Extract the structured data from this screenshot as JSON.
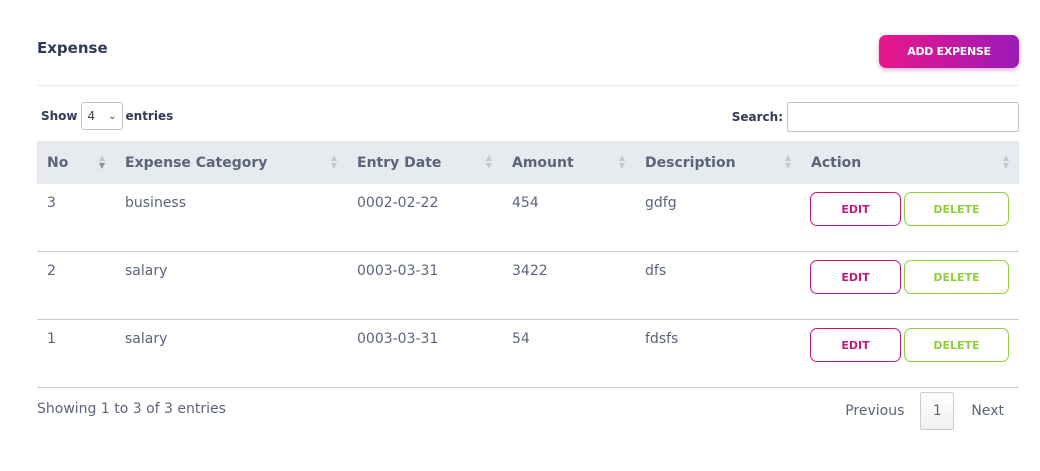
{
  "header": {
    "title": "Expense",
    "add_button": "ADD EXPENSE"
  },
  "controls": {
    "show_label": "Show",
    "entries_value": "4",
    "entries_label": "entries",
    "search_label": "Search:",
    "search_value": ""
  },
  "table": {
    "columns": [
      "No",
      "Expense Category",
      "Entry Date",
      "Amount",
      "Description",
      "Action"
    ],
    "rows": [
      {
        "no": "3",
        "category": "business",
        "date": "0002-02-22",
        "amount": "454",
        "description": "gdfg",
        "edit": "EDIT",
        "delete": "DELETE"
      },
      {
        "no": "2",
        "category": "salary",
        "date": "0003-03-31",
        "amount": "3422",
        "description": "dfs",
        "edit": "EDIT",
        "delete": "DELETE"
      },
      {
        "no": "1",
        "category": "salary",
        "date": "0003-03-31",
        "amount": "54",
        "description": "fdsfs",
        "edit": "EDIT",
        "delete": "DELETE"
      }
    ]
  },
  "footer": {
    "info": "Showing 1 to 3 of 3 entries",
    "previous": "Previous",
    "page": "1",
    "next": "Next"
  },
  "colors": {
    "accent_magenta": "#c2187f",
    "accent_green": "#8fcf3b",
    "gradient_start": "#e8178a",
    "gradient_end": "#9c1ab8"
  }
}
